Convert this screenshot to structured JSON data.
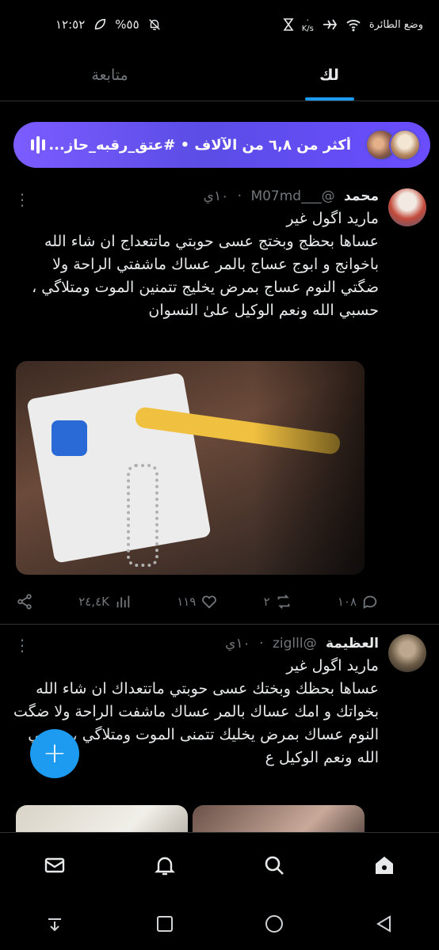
{
  "status_bar": {
    "time": "١٢:٥٢",
    "battery": "%٥٥",
    "airplane_mode_label": "وضع الطائرة",
    "network_speed": "K/s",
    "network_speed_value": "٠"
  },
  "tabs": [
    {
      "label": "متابعة",
      "active": false
    },
    {
      "label": "لك",
      "active": true
    }
  ],
  "spaces": {
    "text": "أكثر من ٦,٨ من الآلاف • #عتق_رقبه_حاز..."
  },
  "tweets": [
    {
      "name": "محمد",
      "handle": "@___M07md",
      "time": "١٠ي",
      "time_separator": "·",
      "text": "ماريد اگول غير\nعساها بحظج وبختج عسى حوبتي ماتتعداج ان شاء الله باخوانج و ابوج عساج بالمر عساك ماشفتي الراحة ولا ضگتي النوم عساج بمرض يخليج تتمنين الموت ومتلاگي ، حسبي الله ونعم الوكيل علىٰ النسوان",
      "replies": "١٠٨",
      "retweets": "٢",
      "likes": "١١٩",
      "views": "٢٤,٤K"
    },
    {
      "name": "العظيمة",
      "handle": "@ziglll",
      "time": "١٠ي",
      "time_separator": "·",
      "text": "ماريد اگول غير\nعساها بحظك وبختك عسى حوبتي ماتتعداك ان شاء الله بخواتك و امك عساك بالمر عساك ماشفت الراحة ولا ضگت النوم عساك بمرض يخليك تتمنى الموت ومتلاگي ، حسبي الله ونعم الوكيل ع"
    }
  ],
  "fab": {
    "label": "+"
  },
  "bottom_nav": [
    "home-icon",
    "search-icon",
    "notifications-icon",
    "messages-icon"
  ],
  "colors": {
    "accent": "#1d9bf0",
    "spaces_pill": "#5b4de6",
    "background": "#000000",
    "muted": "#71767b"
  }
}
